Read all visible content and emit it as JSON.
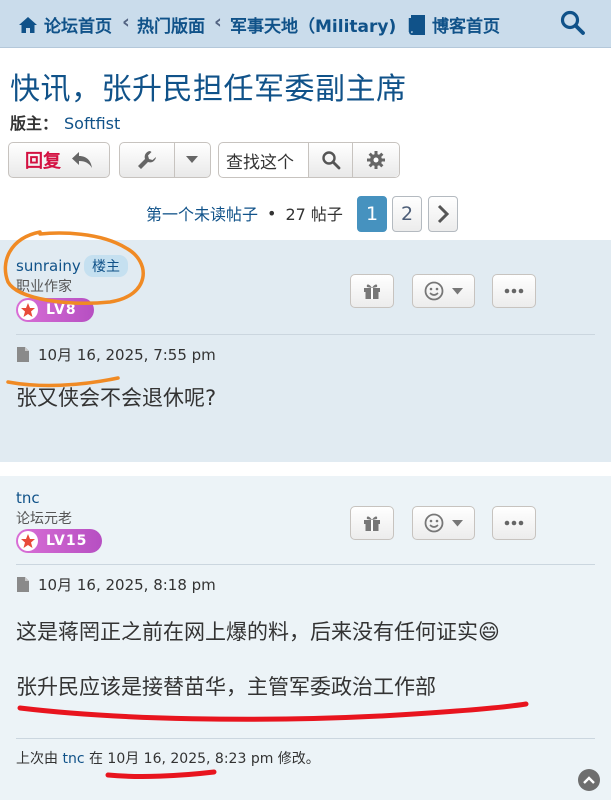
{
  "nav": {
    "crumbs": [
      {
        "label": "论坛首页",
        "icon": "home-icon"
      },
      {
        "label": "热门版面"
      },
      {
        "label": "军事天地（Military)"
      },
      {
        "label": "博客首页",
        "icon": "book-icon"
      }
    ],
    "search_icon": "search-icon"
  },
  "header": {
    "title": "快讯，张升民担任军委副主席",
    "moderator_label": "版主：",
    "moderator_name": "Softfist"
  },
  "actions": {
    "reply_label": "回复",
    "search_placeholder": "查找这个"
  },
  "pagination": {
    "first_unread": "第一个未读帖子",
    "separator": "•",
    "count": "27 帖子",
    "pages": [
      "1",
      "2"
    ],
    "current_page": "1"
  },
  "posts": [
    {
      "author": "sunrainy",
      "op_badge": "楼主",
      "rank": "职业作家",
      "level": "LV8",
      "date": "10月 16, 2025, 7:55 pm",
      "lines": [
        "张又侠会不会退休呢?"
      ]
    },
    {
      "author": "tnc",
      "rank": "论坛元老",
      "level": "LV15",
      "date": "10月 16, 2025, 8:18 pm",
      "lines": [
        "这是蒋罔正之前在网上爆的料，后来没有任何证实",
        "张升民应该是接替苗华，主管军委政治工作部"
      ],
      "emoji": "😄",
      "edited": {
        "prefix": "上次由",
        "by": "tnc",
        "mid": "在",
        "date": "10月 16, 2025, 8:23 pm",
        "suffix": "修改。"
      }
    }
  ],
  "colors": {
    "nav_bg": "#cadceb",
    "link": "#105289",
    "reply": "#d31141",
    "post_bg": "#e1ebf2",
    "annotation_orange": "#f08a24",
    "annotation_red": "#e8141e"
  }
}
